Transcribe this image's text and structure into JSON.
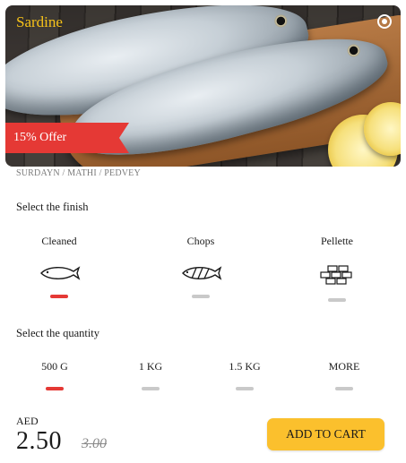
{
  "product": {
    "name": "Sardine",
    "offer": "15% Offer",
    "aliases": "SURDAYN / MATHI / PEDVEY"
  },
  "finish": {
    "label": "Select the finish",
    "options": [
      {
        "label": "Cleaned",
        "icon": "whole-fish-icon",
        "selected": true
      },
      {
        "label": "Chops",
        "icon": "fish-chops-icon",
        "selected": false
      },
      {
        "label": "Pellette",
        "icon": "fish-pieces-icon",
        "selected": false
      }
    ]
  },
  "quantity": {
    "label": "Select the quantity",
    "options": [
      {
        "label": "500 G",
        "selected": true
      },
      {
        "label": "1 KG",
        "selected": false
      },
      {
        "label": "1.5 KG",
        "selected": false
      },
      {
        "label": "MORE",
        "selected": false
      }
    ]
  },
  "price": {
    "currency": "AED",
    "current": "2.50",
    "original": "3.00"
  },
  "actions": {
    "add_to_cart": "ADD TO CART"
  },
  "colors": {
    "accent": "#e53935",
    "title": "#f6c21a",
    "button": "#fbc02d",
    "inactive": "#c9c9c9"
  }
}
